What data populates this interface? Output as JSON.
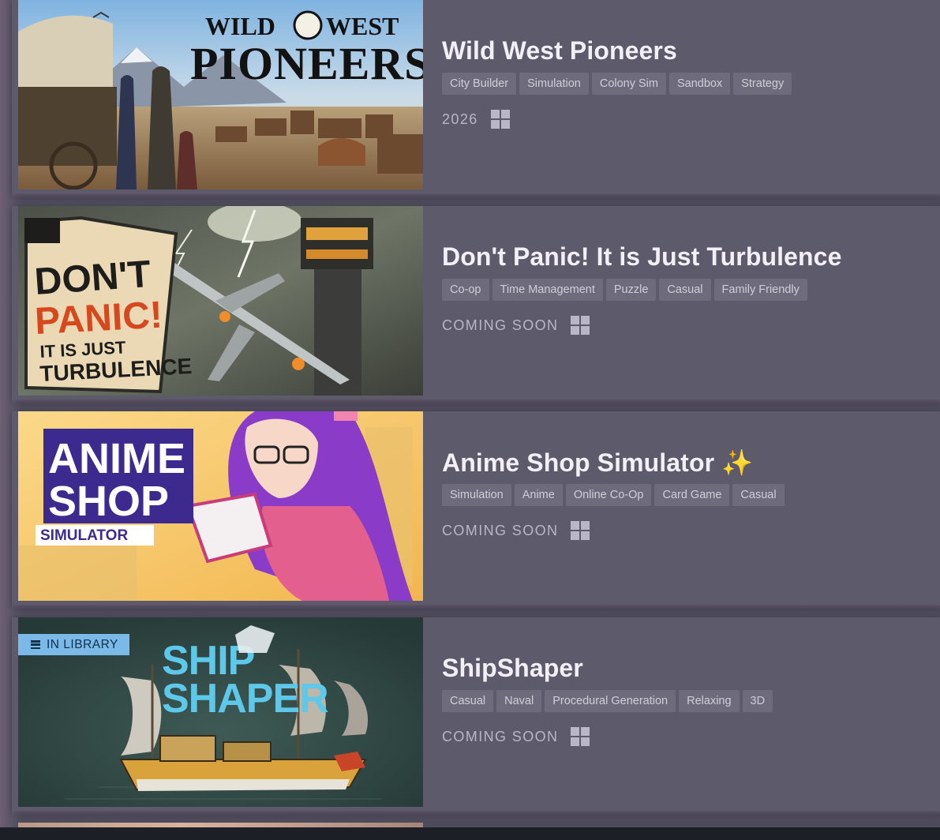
{
  "games": [
    {
      "title": "Wild West Pioneers",
      "tags": [
        "City Builder",
        "Simulation",
        "Colony Sim",
        "Sandbox",
        "Strategy"
      ],
      "release": "2026",
      "platform_icon": "windows-icon",
      "capsule": {
        "line1": "WILD",
        "line1b": "WEST",
        "line2": "PIONEERS"
      }
    },
    {
      "title": "Don't Panic! It is Just Turbulence",
      "tags": [
        "Co-op",
        "Time Management",
        "Puzzle",
        "Casual",
        "Family Friendly"
      ],
      "release": "COMING SOON",
      "platform_icon": "windows-icon",
      "capsule": {
        "line1": "DON'T",
        "line2": "PANIC!",
        "line3": "IT IS JUST",
        "line4": "TURBULENCE"
      }
    },
    {
      "title": "Anime Shop Simulator",
      "title_suffix": "✨",
      "tags": [
        "Simulation",
        "Anime",
        "Online Co-Op",
        "Card Game",
        "Casual"
      ],
      "release": "COMING SOON",
      "platform_icon": "windows-icon",
      "capsule": {
        "line1": "ANIME",
        "line2": "SHOP",
        "line3": "SIMULATOR"
      }
    },
    {
      "title": "ShipShaper",
      "tags": [
        "Casual",
        "Naval",
        "Procedural Generation",
        "Relaxing",
        "3D"
      ],
      "release": "COMING SOON",
      "platform_icon": "windows-icon",
      "badge": "IN LIBRARY",
      "capsule": {
        "line1": "SHIP",
        "line2": "SHAPER"
      }
    }
  ],
  "colors": {
    "page_bg": "#4d4a5a",
    "row_bg": "#5c5a6b",
    "tag_bg": "#6e6c7c",
    "badge_bg": "#7ab9e8"
  }
}
